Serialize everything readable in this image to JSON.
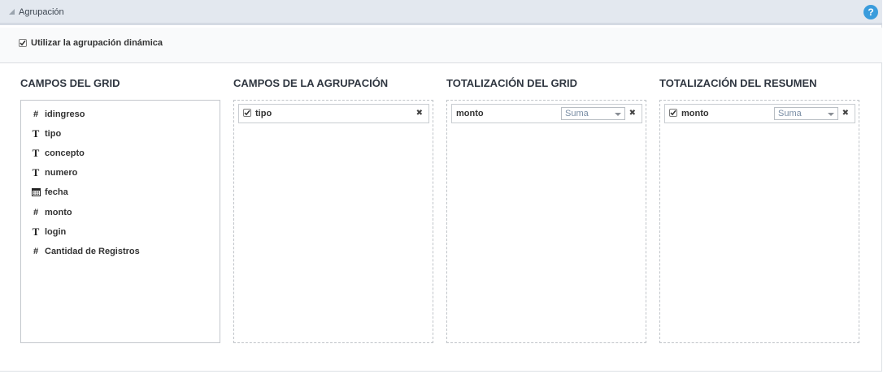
{
  "header": {
    "title": "Agrupación",
    "help_label": "?"
  },
  "options": {
    "dynamic_grouping_label": "Utilizar la agrupación dinámica",
    "dynamic_grouping_checked": true
  },
  "columns": {
    "grid_fields": {
      "title": "CAMPOS DEL GRID",
      "items": [
        {
          "icon": "number-icon",
          "label": "idingreso"
        },
        {
          "icon": "text-icon",
          "label": "tipo"
        },
        {
          "icon": "text-icon",
          "label": "concepto"
        },
        {
          "icon": "text-icon",
          "label": "numero"
        },
        {
          "icon": "calendar-icon",
          "label": "fecha"
        },
        {
          "icon": "number-icon",
          "label": "monto"
        },
        {
          "icon": "text-icon",
          "label": "login"
        },
        {
          "icon": "number-icon",
          "label": "Cantidad de Registros"
        }
      ]
    },
    "grouping_fields": {
      "title": "CAMPOS DE LA AGRUPACIÓN",
      "items": [
        {
          "label": "tipo",
          "checked": true
        }
      ]
    },
    "grid_totals": {
      "title": "TOTALIZACIÓN DEL GRID",
      "items": [
        {
          "label": "monto",
          "function": "Suma"
        }
      ]
    },
    "summary_totals": {
      "title": "TOTALIZACIÓN DEL RESUMEN",
      "items": [
        {
          "label": "monto",
          "function": "Suma",
          "checked": true
        }
      ]
    }
  },
  "icons": {
    "hash_glyph": "#",
    "text_glyph": "T",
    "remove_glyph": "✖"
  },
  "colors": {
    "header_bg": "#e3e8ef",
    "help_blue": "#3a9cdc",
    "select_text": "#7a8ea5"
  }
}
